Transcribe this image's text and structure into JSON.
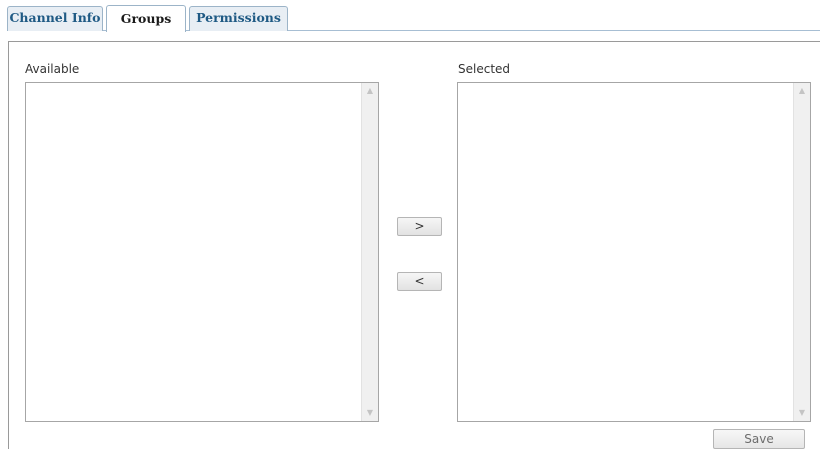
{
  "tabs": [
    {
      "label": "Channel Info",
      "active": false
    },
    {
      "label": "Groups",
      "active": true
    },
    {
      "label": "Permissions",
      "active": false
    }
  ],
  "available": {
    "label": "Available",
    "items": []
  },
  "selected": {
    "label": "Selected",
    "items": []
  },
  "buttons": {
    "add_label": ">",
    "remove_label": "<",
    "save_label": "Save"
  },
  "scrollbar": {
    "up_icon": "scroll-up-arrow-icon",
    "down_icon": "scroll-down-arrow-icon"
  },
  "colors": {
    "tab_text": "#1f5a84",
    "tab_border": "#9cb4c8",
    "active_tab_text": "#1a1a1a"
  }
}
